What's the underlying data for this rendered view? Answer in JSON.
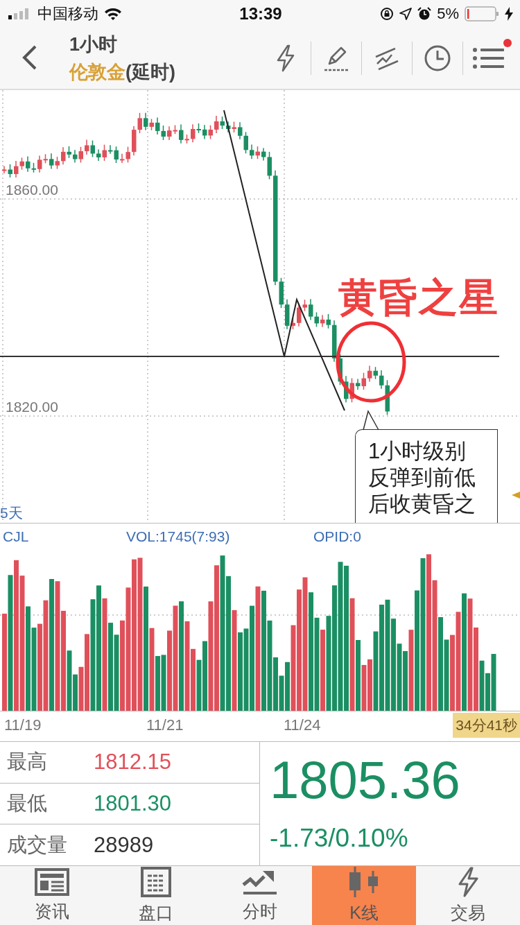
{
  "status_bar": {
    "carrier": "中国移动",
    "time": "13:39",
    "battery": "5%"
  },
  "header": {
    "title": "1小时",
    "instrument": "伦敦金",
    "delay_note": "(延时)",
    "menu_badge": true
  },
  "price_chart": {
    "y_labels": [
      "1860.00",
      "1820.00"
    ],
    "range_label": "5天",
    "annotation_title": "黄昏之星",
    "callout_lines": [
      "1小时级别",
      "反弹到前低",
      "后收黄昏之"
    ]
  },
  "indicator_bar": [
    "CJL",
    "VOL:1745(7:93)",
    "OPID:0"
  ],
  "date_axis": {
    "labels": [
      "11/19",
      "11/21",
      "11/24"
    ],
    "countdown": "34分41秒"
  },
  "quote": {
    "stats": [
      {
        "label": "最高",
        "value": "1812.15",
        "color": "#e0505a"
      },
      {
        "label": "最低",
        "value": "1801.30",
        "color": "#1b8f63"
      },
      {
        "label": "成交量",
        "value": "28989",
        "color": "#333333"
      }
    ],
    "price": "1805.36",
    "change": "-1.73/0.10%",
    "color": "#1b8f63"
  },
  "tabs": [
    {
      "label": "资讯",
      "kind": "news",
      "selected": false
    },
    {
      "label": "盘口",
      "kind": "book",
      "selected": false
    },
    {
      "label": "分时",
      "kind": "trend",
      "selected": false
    },
    {
      "label": "K线",
      "kind": "candles",
      "selected": true
    },
    {
      "label": "交易",
      "kind": "bolt",
      "selected": false
    }
  ]
}
